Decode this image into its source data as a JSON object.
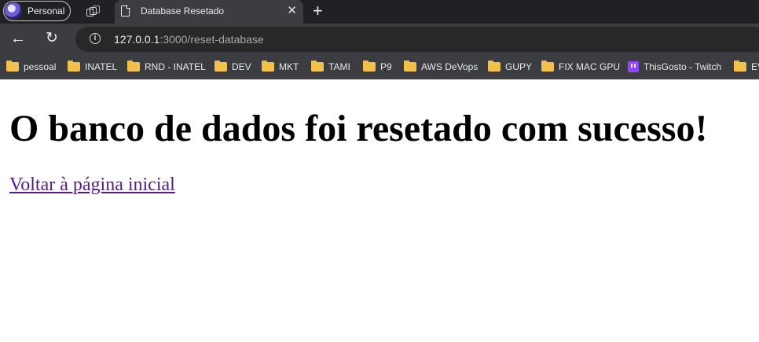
{
  "browser": {
    "profile_label": "Personal",
    "tab": {
      "title": "Database Resetado",
      "close": "✕"
    },
    "new_tab": "+",
    "address": {
      "host": "127.0.0.1",
      "path": ":3000/reset-database"
    },
    "bookmarks": [
      {
        "label": "pessoal",
        "icon": "folder-icon"
      },
      {
        "label": "INATEL",
        "icon": "folder-icon"
      },
      {
        "label": "RND - INATEL",
        "icon": "folder-icon"
      },
      {
        "label": "DEV",
        "icon": "folder-icon"
      },
      {
        "label": "MKT",
        "icon": "folder-icon"
      },
      {
        "label": "TAMI",
        "icon": "folder-icon"
      },
      {
        "label": "P9",
        "icon": "folder-icon"
      },
      {
        "label": "AWS DeVops",
        "icon": "folder-icon"
      },
      {
        "label": "GUPY",
        "icon": "folder-icon"
      },
      {
        "label": "FIX MAC GPU",
        "icon": "folder-icon"
      },
      {
        "label": "ThisGosto - Twitch",
        "icon": "twitch-icon"
      },
      {
        "label": "EV",
        "icon": "folder-icon"
      }
    ]
  },
  "page": {
    "heading": "O banco de dados foi resetado com sucesso!",
    "link_label": "Voltar à página inicial"
  },
  "colors": {
    "tabstrip": "#202124",
    "toolbar": "#3c3d40",
    "folder": "#f3c14b",
    "twitch": "#9146ff",
    "visited_link": "#551a8b"
  }
}
